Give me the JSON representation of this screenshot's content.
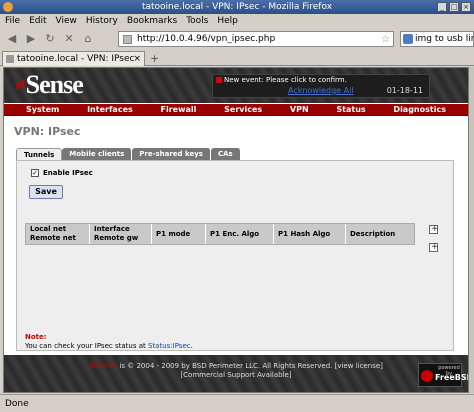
{
  "window": {
    "title": "tatooine.local - VPN: IPsec - Mozilla Firefox"
  },
  "menubar": [
    "File",
    "Edit",
    "View",
    "History",
    "Bookmarks",
    "Tools",
    "Help"
  ],
  "navigation": {
    "url": "http://10.0.4.96/vpn_ipsec.php",
    "search": "img to usb linux"
  },
  "browser_tab": {
    "label": "tatooine.local - VPN: IPsec"
  },
  "header": {
    "logo_prefix": "pf",
    "logo": "Sense",
    "event_text": "New event: Please click to confirm.",
    "acknowledge": "Acknowledge All",
    "date": "01-18-11"
  },
  "mainnav": [
    "System",
    "Interfaces",
    "Firewall",
    "Services",
    "VPN",
    "Status",
    "Diagnostics"
  ],
  "page": {
    "title": "VPN: IPsec",
    "tabs": [
      "Tunnels",
      "Mobile clients",
      "Pre-shared keys",
      "CAs"
    ],
    "enable_label": "Enable IPsec",
    "enable_checked": true,
    "save_label": "Save",
    "table_headers": {
      "local_net": "Local net",
      "remote_net": "Remote net",
      "interface": "Interface",
      "remote_gw": "Remote gw",
      "p1_mode": "P1 mode",
      "p1_enc": "P1 Enc. Algo",
      "p1_hash": "P1 Hash Algo",
      "description": "Description"
    },
    "note_label": "Note:",
    "note_text": "You can check your IPsec status at ",
    "note_link": "Status:IPsec",
    "note_end": "."
  },
  "footer": {
    "brand": "pfSense",
    "line1": " is © 2004 - 2009 by BSD Perimeter LLC. All Rights Reserved. [",
    "view_license": "view license",
    "line1_end": "]",
    "line2": "[Commercial Support Available]",
    "badge_top": "powered by",
    "badge_name": "FreeBSD"
  },
  "status": "Done"
}
